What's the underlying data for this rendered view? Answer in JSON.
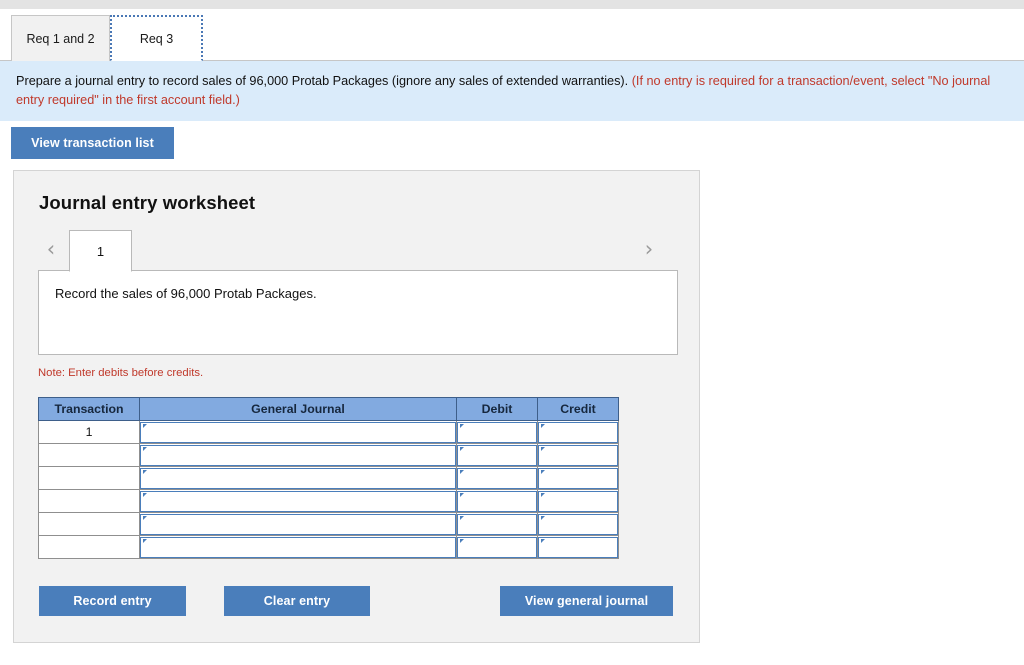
{
  "tabs": [
    {
      "label": "Req 1 and 2",
      "active": false
    },
    {
      "label": "Req 3",
      "active": true
    }
  ],
  "instructions": {
    "main": "Prepare a journal entry to record sales of 96,000 Protab Packages (ignore any sales of extended warranties). ",
    "hint": "(If no entry is required for a transaction/event, select \"No journal entry required\" in the first account field.)"
  },
  "toolbar": {
    "view_transaction_list_label": "View transaction list"
  },
  "worksheet": {
    "title": "Journal entry worksheet",
    "pager": {
      "prev_icon": "‹",
      "next_icon": "›",
      "current_page": "1"
    },
    "description": "Record the sales of 96,000 Protab Packages.",
    "note": "Note: Enter debits before credits.",
    "table": {
      "headers": [
        "Transaction",
        "General Journal",
        "Debit",
        "Credit"
      ],
      "rows": [
        {
          "transaction": "1",
          "general_journal": "",
          "debit": "",
          "credit": ""
        },
        {
          "transaction": "",
          "general_journal": "",
          "debit": "",
          "credit": ""
        },
        {
          "transaction": "",
          "general_journal": "",
          "debit": "",
          "credit": ""
        },
        {
          "transaction": "",
          "general_journal": "",
          "debit": "",
          "credit": ""
        },
        {
          "transaction": "",
          "general_journal": "",
          "debit": "",
          "credit": ""
        },
        {
          "transaction": "",
          "general_journal": "",
          "debit": "",
          "credit": ""
        }
      ]
    },
    "actions": {
      "record_entry_label": "Record entry",
      "clear_entry_label": "Clear entry",
      "view_general_journal_label": "View general journal"
    }
  },
  "colors": {
    "button_blue": "#4a7ebb",
    "table_header_blue": "#82aae0",
    "banner_blue": "#daebfa",
    "note_red": "#c0392b",
    "panel_gray": "#f2f2f2"
  }
}
